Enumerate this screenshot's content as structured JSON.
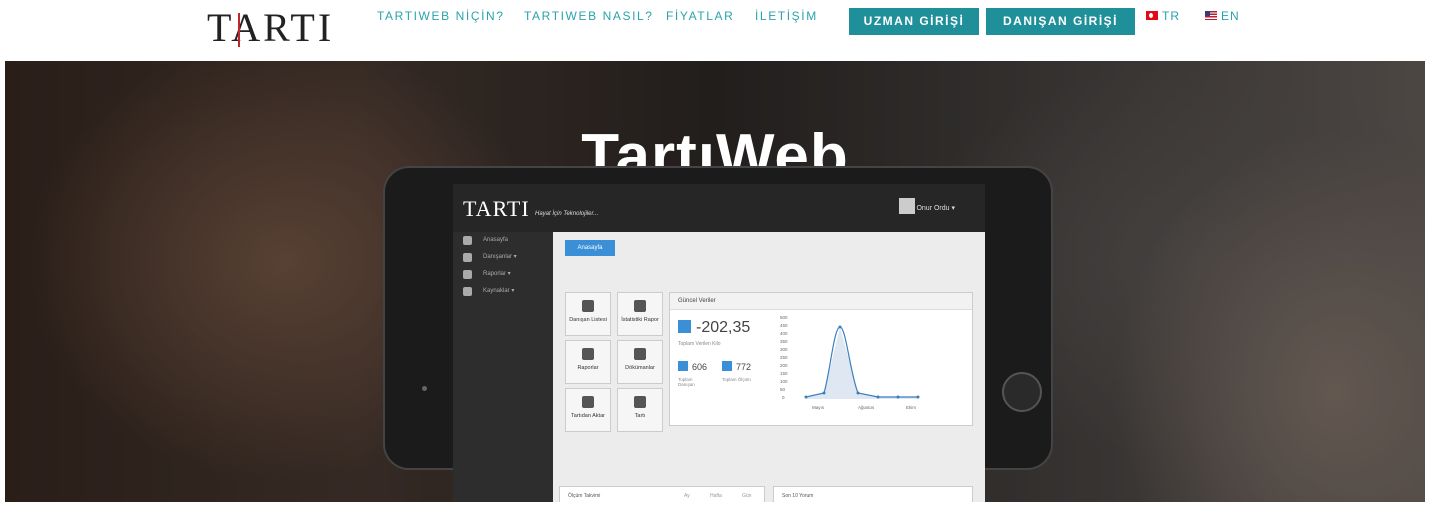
{
  "header": {
    "logo": "TARTI",
    "nav": [
      {
        "label": "TARTIWEB NİÇİN?"
      },
      {
        "label": "TARTIWEB NASIL?"
      },
      {
        "label": "FİYATLAR"
      },
      {
        "label": "İLETİŞİM"
      }
    ],
    "expert_login": "UZMAN GİRİŞİ",
    "client_login": "DANIŞAN GİRİŞİ",
    "lang_tr": "TR",
    "lang_en": "EN"
  },
  "hero": {
    "title": "TartıWeb"
  },
  "tablet_screen": {
    "logo": "TARTI",
    "tagline": "Hayat İçin Teknolojiler...",
    "user": "Onur Ordu ▾",
    "sidebar": [
      "Anasayfa",
      "Danışanlar ▾",
      "Raporlar ▾",
      "Kaynaklar ▾"
    ],
    "breadcrumb": "Anasayfa",
    "tiles": [
      "Danışan Listesi",
      "İstatistiki Rapor",
      "Raporlar",
      "Dökümanlar",
      "Tartıdan Aktar",
      "Tartı"
    ],
    "panel_title": "Güncel Veriler",
    "total_kilo": "-202,35",
    "total_kilo_label": "Toplam Verilen Kilo",
    "stat1_value": "606",
    "stat1_label": "Toplam Danışan",
    "stat2_value": "772",
    "stat2_label": "Toplam Ölçüm",
    "chart_y_ticks": [
      "500",
      "450",
      "400",
      "350",
      "300",
      "250",
      "200",
      "150",
      "100",
      "50",
      "0"
    ],
    "chart_x_ticks": [
      "Mayıs",
      "Ağustos",
      "Ekim"
    ],
    "calendar_title": "Ölçüm Takvimi",
    "calendar_tabs": [
      "Ay",
      "Hafta",
      "Gün"
    ],
    "comments_title": "Son 10 Yorum"
  },
  "colors": {
    "accent": "#2aa3ad",
    "button": "#1f8f9a",
    "logo_bar": "#c0272d"
  }
}
